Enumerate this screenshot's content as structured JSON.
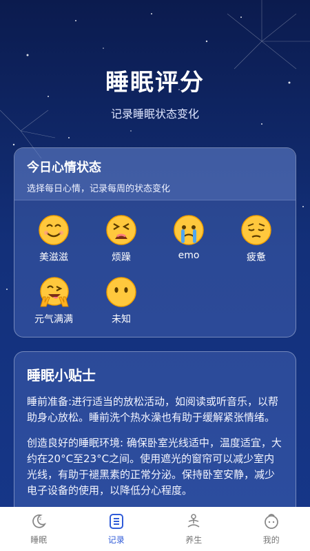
{
  "header": {
    "title": "睡眠评分",
    "subtitle": "记录睡眠状态变化"
  },
  "mood_card": {
    "title": "今日心情状态",
    "description": "选择每日心情，记录每周的状态变化",
    "moods": [
      {
        "label": "美滋滋",
        "icon": "smiling-face-icon"
      },
      {
        "label": "烦躁",
        "icon": "tired-face-icon"
      },
      {
        "label": "emo",
        "icon": "crying-face-icon"
      },
      {
        "label": "疲惫",
        "icon": "pensive-face-icon"
      },
      {
        "label": "元气满满",
        "icon": "victory-face-icon"
      },
      {
        "label": "未知",
        "icon": "blank-face-icon"
      }
    ]
  },
  "tips_card": {
    "title": "睡眠小贴士",
    "paragraphs": [
      "睡前准备:进行适当的放松活动，如阅读或听音乐，以帮助身心放松。睡前洗个热水澡也有助于缓解紧张情绪。",
      "创造良好的睡眠环境: 确保卧室光线适中，温度适宜，大约在20°C至23°C之间。使用遮光的窗帘可以减少室内光线，有助于褪黑素的正常分泌。保持卧室安静，减少电子设备的使用，以降低分心程度。"
    ]
  },
  "tabbar": {
    "active": "记录",
    "accent": "#2f5bd8",
    "tabs": [
      {
        "label": "睡眠",
        "icon": "moon-icon"
      },
      {
        "label": "记录",
        "icon": "list-icon"
      },
      {
        "label": "养生",
        "icon": "meditation-icon"
      },
      {
        "label": "我的",
        "icon": "profile-face-icon"
      }
    ]
  }
}
